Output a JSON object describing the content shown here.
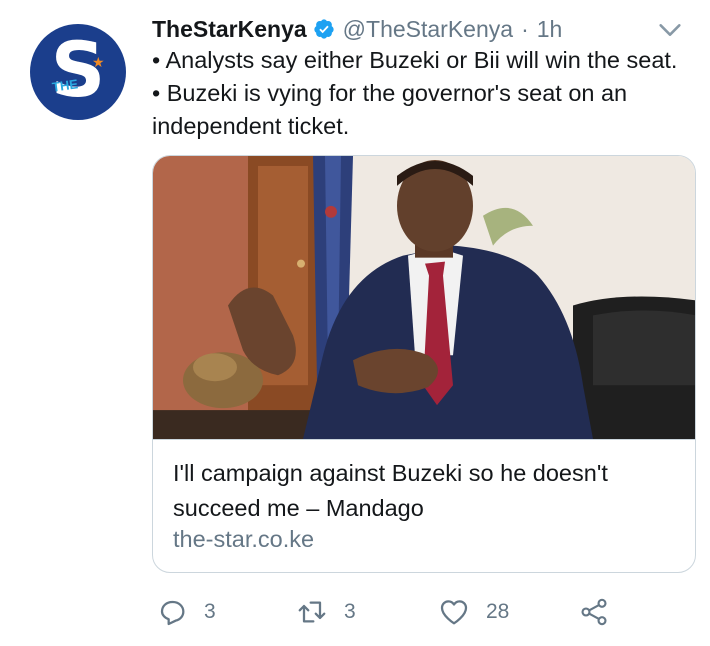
{
  "account": {
    "name": "TheStarKenya",
    "handle": "@TheStarKenya",
    "separator": "·",
    "time": "1h",
    "avatar_icon": "the-star-logo-icon"
  },
  "tweet": {
    "text": "• Analysts say either Buzeki or Bii will win the seat. • Buzeki is vying for the governor's seat on an independent ticket."
  },
  "card": {
    "title": "I'll campaign against Buzeki so he doesn't succeed me – Mandago",
    "domain": "the-star.co.ke"
  },
  "actions": {
    "reply_count": "3",
    "retweet_count": "3",
    "like_count": "28"
  },
  "colors": {
    "accent": "#1da1f2",
    "secondary_text": "#657786",
    "border": "#ccd6dd",
    "avatar_bg": "#1b3e8c"
  }
}
